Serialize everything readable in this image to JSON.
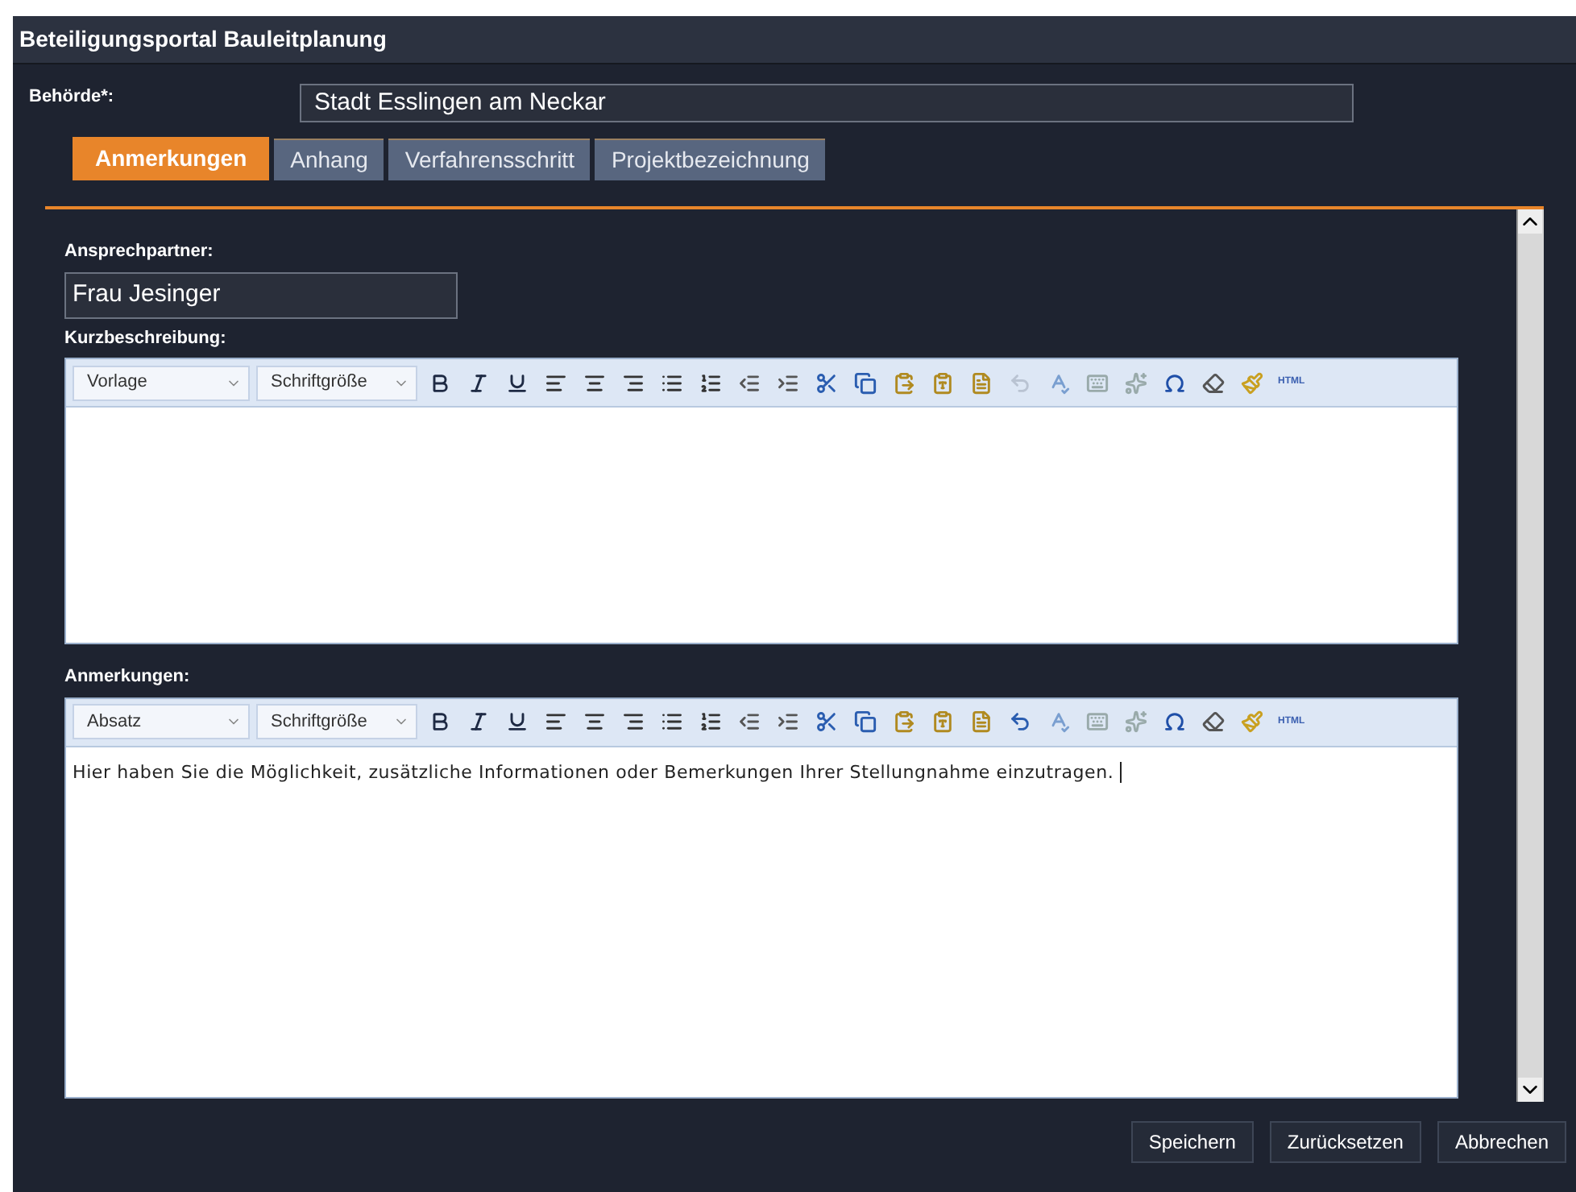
{
  "window": {
    "title": "Beteiligungsportal Bauleitplanung"
  },
  "authority": {
    "label": "Behörde*:",
    "value": "Stadt Esslingen am Neckar"
  },
  "tabs": [
    {
      "label": "Anmerkungen",
      "selected": true
    },
    {
      "label": "Anhang",
      "selected": false
    },
    {
      "label": "Verfahrensschritt",
      "selected": false
    },
    {
      "label": "Projektbezeichnung",
      "selected": false
    }
  ],
  "contact": {
    "label": "Ansprechpartner:",
    "value": "Frau Jesinger"
  },
  "editors": [
    {
      "label": "Kurzbeschreibung:",
      "format": "Vorlage",
      "size": "Schriftgröße",
      "html_button": "HTML",
      "undo_disabled": true
    },
    {
      "label": "Anmerkungen:",
      "format": "Absatz",
      "size": "Schriftgröße",
      "html_button": "HTML",
      "undo_disabled": false,
      "text": "Hier haben Sie die Möglichkeit, zusätzliche Informationen oder Bemerkungen Ihrer Stellungnahme einzutragen."
    }
  ],
  "buttons": [
    "Speichern",
    "Zurücksetzen",
    "Abbrechen"
  ]
}
